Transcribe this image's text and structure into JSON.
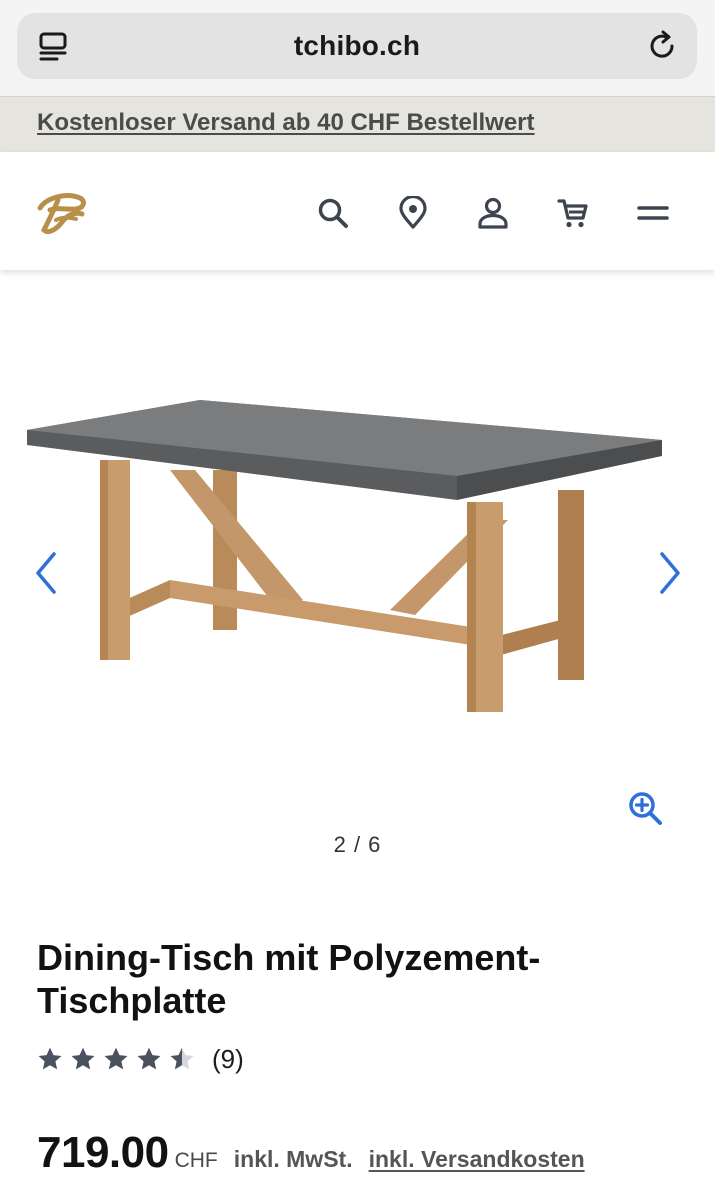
{
  "browser": {
    "url": "tchibo.ch"
  },
  "promo": {
    "text": "Kostenloser Versand ab 40 CHF Bestellwert"
  },
  "header": {
    "icons": [
      "tchibo-logo",
      "search-icon",
      "location-pin-icon",
      "account-icon",
      "cart-icon",
      "menu-icon"
    ]
  },
  "gallery": {
    "counter": "2 / 6",
    "current": 2,
    "total": 6
  },
  "product": {
    "title": "Dining-Tisch mit Polyzement-Tischplatte",
    "rating": {
      "value": 4.5,
      "max": 5,
      "count_label": "(9)"
    },
    "price": {
      "amount": "719.00",
      "currency": "CHF",
      "vat_note": "inkl. MwSt.",
      "shipping_link": "inkl. Versandkosten"
    }
  },
  "colors": {
    "accent_blue": "#2f6fd9",
    "logo_gold": "#b8904a",
    "icon_gray": "#3d4450",
    "star_gray": "#4a5260",
    "promo_bg": "#e6e4de"
  }
}
